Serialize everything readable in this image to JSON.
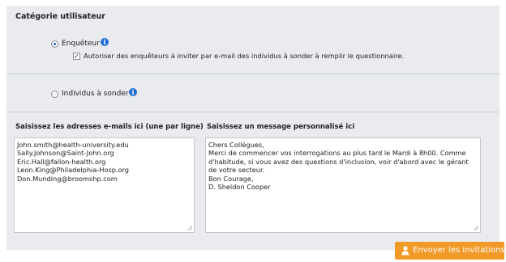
{
  "category": {
    "title": "Catégorie utilisateur",
    "option_enqueteur": "Enquêteur",
    "option_enqueteur_selected": true,
    "checkbox_label": "Autoriser des enquêteurs à inviter par e-mail des individus à sonder à remplir le questionnaire.",
    "checkbox_checked": true,
    "option_individus": "Individus à sonder",
    "option_individus_selected": false,
    "info_glyph": "i"
  },
  "emails": {
    "title": "Saisissez les adresses e-mails ici (une par ligne)",
    "lines": [
      "John.smith@health-university.edu",
      "Sally.Johnson@Saint-John.org",
      "Eric.Hall@fallon-health.org",
      "Leon.King@Philadelphia-Hosp.org",
      "Don.Munding@broomshp.com"
    ]
  },
  "message": {
    "title": "Saisissez un message personnalisé ici",
    "lines": [
      "Chers Collègues,",
      "Merci de commencer vos interrogations au plus tard le Mardi à 8h00. Comme",
      "d'habitude, si vous avez des questions d'inclusion, voir d'abord avec le gérant",
      "de votre secteur.",
      "Bon Courage,",
      "D. Sheldon Cooper"
    ]
  },
  "actions": {
    "send_label": "Envoyer les invitations",
    "send_color": "#f29a27"
  },
  "icons": {
    "info": "info-icon",
    "send": "add-user-icon"
  }
}
